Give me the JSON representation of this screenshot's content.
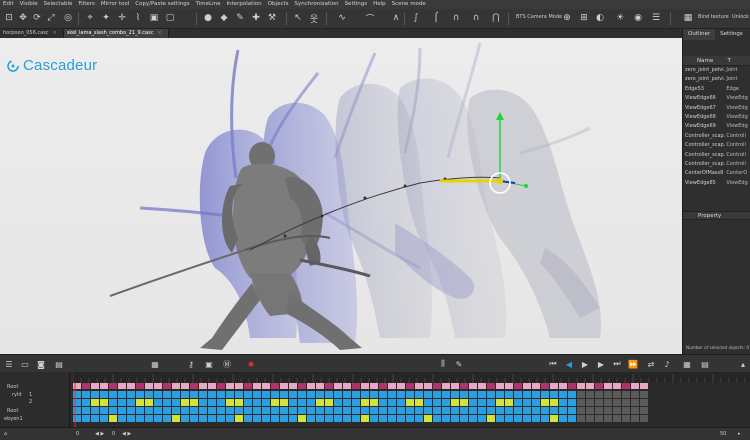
{
  "menu": [
    "Edit",
    "Visible",
    "Selectable",
    "Filters",
    "Mirror tool",
    "Copy/Paste settings",
    "TimeLine",
    "Interpolation",
    "Objects",
    "Synchronization",
    "Settings",
    "Help",
    "Scene mode"
  ],
  "toolbar": {
    "camera_mode_label": "BTS Camera Mode",
    "bind_texture_label": "Bind texture",
    "unlock_label": "Unlock"
  },
  "file_tabs": [
    {
      "label": "horpoon_056.casc",
      "active": false
    },
    {
      "label": "skel_lama_slash_combo_21_9.casc",
      "active": true
    }
  ],
  "brand": {
    "name": "Cascadeur",
    "accent": "#2a9ed8"
  },
  "right_panel": {
    "tabs": [
      "Outliner",
      "Settings"
    ],
    "columns": [
      "Name",
      "T"
    ],
    "rows": [
      {
        "name": "zero_joint_pelvi...",
        "type": "Joint"
      },
      {
        "name": "zero_joint_pelvi...",
        "type": "Joint"
      },
      {
        "name": "Edge53",
        "type": "Edge"
      },
      {
        "name": "ViewEdge66",
        "type": "ViewEdg"
      },
      {
        "name": "ViewEdge67",
        "type": "ViewEdg"
      },
      {
        "name": "ViewEdge68",
        "type": "ViewEdg"
      },
      {
        "name": "ViewEdge69",
        "type": "ViewEdg"
      },
      {
        "name": "Controller_scap...",
        "type": "Controll"
      },
      {
        "name": "Controller_scap...",
        "type": "Controll"
      },
      {
        "name": "Controller_scap...",
        "type": "Controll"
      },
      {
        "name": "Controller_scap...",
        "type": "Controll"
      },
      {
        "name": "CenterOfMass8",
        "type": "CenterO"
      },
      {
        "name": "ViewEdge85",
        "type": "ViewEdg"
      }
    ],
    "property_label": "Property",
    "selected_count_label": "Number of selected objects: 0"
  },
  "timeline": {
    "track_labels": [
      "Root",
      "rylit",
      "1",
      "2",
      "Root",
      "ebyen1"
    ]
  },
  "status": {
    "left_value": "0",
    "left_value2": "0",
    "right_value": "50"
  },
  "colors": {
    "bg_dark": "#2b2b2b",
    "viewport_bg": "#ececec",
    "track_pink": "#e8a8c4",
    "track_magenta": "#b0326a",
    "track_blue": "#2b9fe0",
    "track_yellow": "#d4e33a",
    "track_grey": "#5a5a5a",
    "curve_yellow": "#e6d400",
    "gizmo_green": "#22d43a"
  }
}
